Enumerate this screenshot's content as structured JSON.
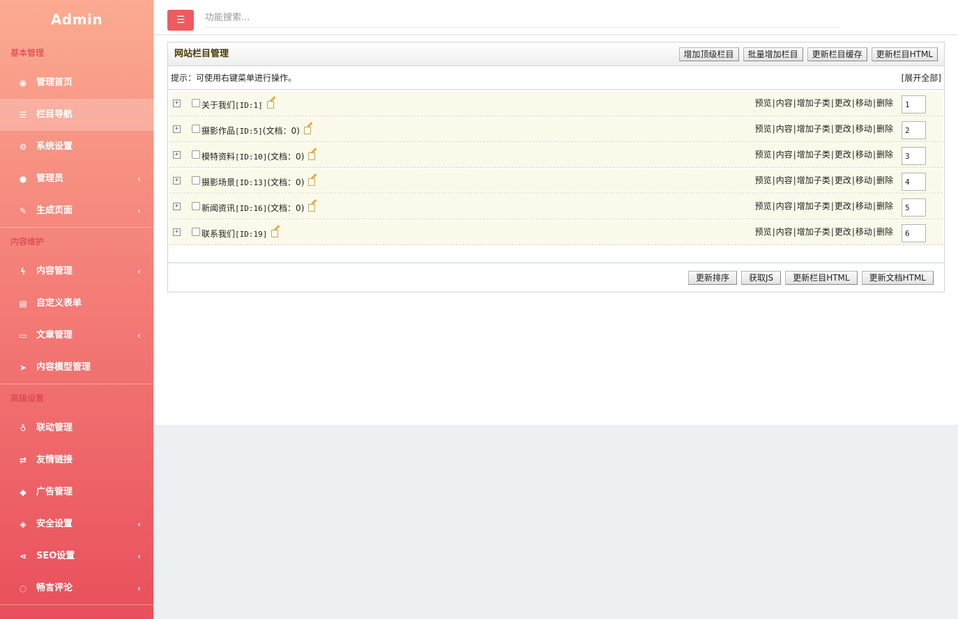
{
  "sidebar": {
    "brand": "Admin",
    "sections": [
      {
        "title": "基本管理",
        "items": [
          {
            "label": "管理首页",
            "icon": "dashboard-icon",
            "glyph": "◉",
            "chevron": false,
            "active": false
          },
          {
            "label": "栏目导航",
            "icon": "list-icon",
            "glyph": "☰",
            "chevron": false,
            "active": true
          },
          {
            "label": "系统设置",
            "icon": "gear-icon",
            "glyph": "⚙",
            "chevron": false,
            "active": false
          },
          {
            "label": "管理员",
            "icon": "user-icon",
            "glyph": "●",
            "chevron": true,
            "active": false
          },
          {
            "label": "生成页面",
            "icon": "brush-icon",
            "glyph": "✎",
            "chevron": true,
            "active": false
          }
        ]
      },
      {
        "title": "内容维护",
        "items": [
          {
            "label": "内容管理",
            "icon": "bolt-icon",
            "glyph": "ϟ",
            "chevron": true,
            "active": false
          },
          {
            "label": "自定义表单",
            "icon": "form-icon",
            "glyph": "▤",
            "chevron": false,
            "active": false
          },
          {
            "label": "文章管理",
            "icon": "folder-icon",
            "glyph": "▭",
            "chevron": true,
            "active": false
          },
          {
            "label": "内容模型管理",
            "icon": "send-icon",
            "glyph": "➤",
            "chevron": false,
            "active": false
          }
        ]
      },
      {
        "title": "高级设置",
        "items": [
          {
            "label": "联动管理",
            "icon": "bulb-icon",
            "glyph": "♁",
            "chevron": false,
            "active": false
          },
          {
            "label": "友情链接",
            "icon": "retweet-icon",
            "glyph": "⇄",
            "chevron": false,
            "active": false
          },
          {
            "label": "广告管理",
            "icon": "cube-icon",
            "glyph": "◆",
            "chevron": false,
            "active": false
          },
          {
            "label": "安全设置",
            "icon": "shield-icon",
            "glyph": "◈",
            "chevron": true,
            "active": false
          },
          {
            "label": "SEO设置",
            "icon": "share-icon",
            "glyph": "⋖",
            "chevron": true,
            "active": false
          },
          {
            "label": "畅言评论",
            "icon": "comments-icon",
            "glyph": "◌",
            "chevron": true,
            "active": false
          }
        ]
      }
    ]
  },
  "topbar": {
    "menu_icon": "☰",
    "search_placeholder": "功能搜索..."
  },
  "panel": {
    "title": "网站栏目管理",
    "header_buttons": [
      "增加顶级栏目",
      "批量增加栏目",
      "更新栏目缓存",
      "更新栏目HTML"
    ],
    "tip": "提示：可使用右键菜单进行操作。",
    "expand_all": "[展开全部]",
    "categories": [
      {
        "name": "关于我们",
        "id": "[ID:1]",
        "docs": "",
        "order": "1"
      },
      {
        "name": "摄影作品",
        "id": "[ID:5]",
        "docs": "(文档：0)",
        "order": "2"
      },
      {
        "name": "模特资料",
        "id": "[ID:10]",
        "docs": "(文档：0)",
        "order": "3"
      },
      {
        "name": "摄影场景",
        "id": "[ID:13]",
        "docs": "(文档：0)",
        "order": "4"
      },
      {
        "name": "新闻资讯",
        "id": "[ID:16]",
        "docs": "(文档：0)",
        "order": "5"
      },
      {
        "name": "联系我们",
        "id": "[ID:19]",
        "docs": "",
        "order": "6"
      }
    ],
    "row_actions": [
      "预览",
      "内容",
      "增加子类",
      "更改",
      "移动",
      "删除"
    ],
    "footer_buttons": [
      "更新排序",
      "获取JS",
      "更新栏目HTML",
      "更新文档HTML"
    ]
  },
  "colors": {
    "accent": "#ee5a5f",
    "sidebar_top": "#fbab91",
    "sidebar_bottom": "#e94f5c",
    "row_bg": "#fbfaea"
  }
}
